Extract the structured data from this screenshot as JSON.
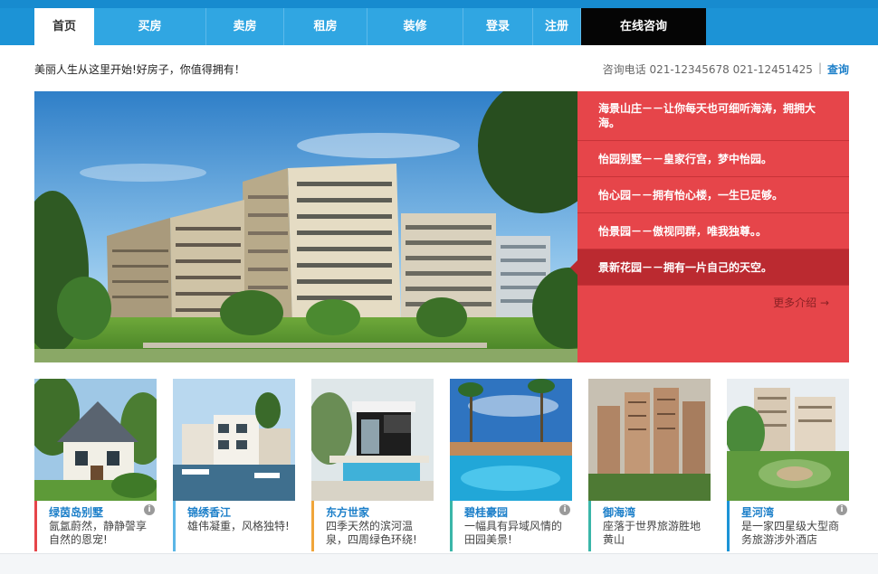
{
  "nav": {
    "items": [
      {
        "label": "首页"
      },
      {
        "label": "买房"
      },
      {
        "label": "卖房"
      },
      {
        "label": "租房"
      },
      {
        "label": "装修"
      },
      {
        "label": "登录"
      },
      {
        "label": "注册"
      },
      {
        "label": "在线咨询"
      }
    ]
  },
  "header": {
    "slogan": "美丽人生从这里开始!好房子，你值得拥有！",
    "phone": "咨询电话 021-12345678 021-12451425",
    "separator": "|",
    "search_label": "查询"
  },
  "promo": {
    "items": [
      {
        "text": "海景山庄－－让你每天也可细听海涛，拥拥大海。"
      },
      {
        "text": "怡园别墅－－皇家行宫，梦中怡园。"
      },
      {
        "text": "怡心园－－拥有怡心楼，一生已足够。"
      },
      {
        "text": "怡景园－－傲视同群，唯我独尊。。"
      },
      {
        "text": "景新花园－－拥有一片自己的天空。"
      }
    ],
    "more_label": "更多介绍 →"
  },
  "cards": [
    {
      "title": "绿茵岛别墅",
      "desc": "氤氲蔚然，静静謦享自然的恩宠!",
      "accent": "#e6454a",
      "title_color": "#1c7fc9"
    },
    {
      "title": "锦绣香江",
      "desc": "雄伟凝重，风格独特!",
      "accent": "#5bb6e6",
      "title_color": "#1c7fc9"
    },
    {
      "title": "东方世家",
      "desc": "四季天然的滨河温泉，四周绿色环绕!",
      "accent": "#f0a53a",
      "title_color": "#1c7fc9"
    },
    {
      "title": "碧桂豪园",
      "desc": "一幅具有异域风情的田园美景!",
      "accent": "#3ab6a9",
      "title_color": "#1c7fc9"
    },
    {
      "title": "御海湾",
      "desc": "座落于世界旅游胜地黄山",
      "accent": "#3ab6a9",
      "title_color": "#1c7fc9"
    },
    {
      "title": "星河湾",
      "desc": "是一家四星级大型商务旅游涉外酒店",
      "accent": "#1c93d6",
      "title_color": "#1c7fc9"
    }
  ],
  "colors": {
    "nav_blue": "#1c93d6",
    "promo_red": "#e6454a",
    "promo_active": "#bb2a30"
  },
  "icons": {
    "info": "info-icon",
    "arrow": "arrow-right-icon"
  }
}
